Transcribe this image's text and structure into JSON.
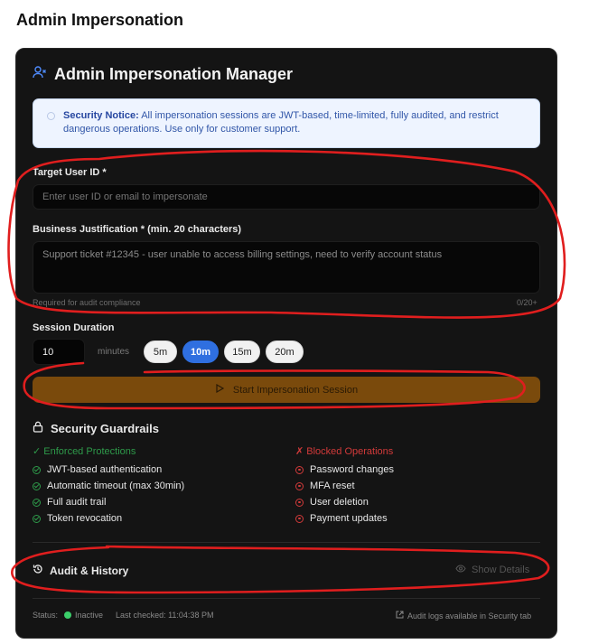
{
  "page": {
    "title": "Admin Impersonation"
  },
  "card": {
    "title": "Admin Impersonation Manager",
    "notice": {
      "label": "Security Notice:",
      "text": " All impersonation sessions are JWT-based, time-limited, fully audited, and restrict dangerous operations. Use only for customer support."
    },
    "target": {
      "label": "Target User ID *",
      "placeholder": "Enter user ID or email to impersonate"
    },
    "justification": {
      "label": "Business Justification * (min. 20 characters)",
      "value": "Support ticket #12345 - user unable to access billing settings, need to verify account status",
      "hint": "Required for audit compliance",
      "counter": "0/20+"
    },
    "duration": {
      "label": "Session Duration",
      "value": "10",
      "unit": "minutes",
      "presets": [
        "5m",
        "10m",
        "15m",
        "20m"
      ],
      "selected": "10m"
    },
    "start_button": "Start Impersonation Session",
    "guardrails": {
      "title": "Security Guardrails",
      "enforced_title": "✓ Enforced Protections",
      "blocked_title": "✗ Blocked Operations",
      "enforced": [
        "JWT-based authentication",
        "Automatic timeout (max 30min)",
        "Full audit trail",
        "Token revocation"
      ],
      "blocked": [
        "Password changes",
        "MFA reset",
        "User deletion",
        "Payment updates"
      ]
    },
    "audit": {
      "title": "Audit & History",
      "show_details": "Show Details"
    },
    "footer": {
      "status_label": "Status:",
      "status_value": "Inactive",
      "last_checked": "Last checked: 11:04:38 PM",
      "audit_link": "Audit logs available in Security tab"
    }
  },
  "colors": {
    "card_bg": "#141414",
    "accent_blue": "#2f6fe0",
    "start_button": "#7a4a0c",
    "ok_green": "#2e9a4a",
    "blocked_red": "#d23a3a",
    "annotation_red": "#e01e1e"
  }
}
